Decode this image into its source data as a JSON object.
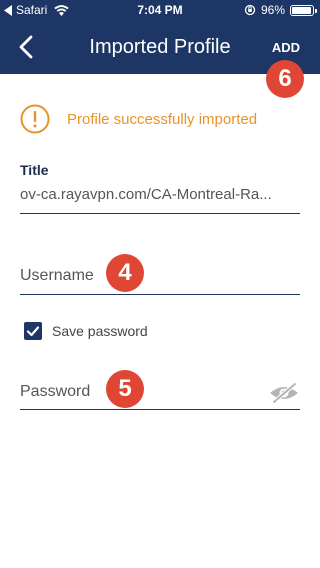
{
  "statusbar": {
    "carrier": "Safari",
    "time": "7:04 PM",
    "battery_percent": "96%",
    "battery_level": 0.96
  },
  "header": {
    "title": "Imported Profile",
    "add_label": "ADD"
  },
  "badges": {
    "add": "6",
    "username": "4",
    "password": "5"
  },
  "notice": {
    "text": "Profile successfully imported"
  },
  "form": {
    "title_label": "Title",
    "title_value": "ov-ca.rayavpn.com/CA-Montreal-Ra...",
    "username_placeholder": "Username",
    "save_password_label": "Save password",
    "save_password_checked": true,
    "password_placeholder": "Password"
  },
  "colors": {
    "header": "#1e3666",
    "accent": "#e8932a",
    "badge": "#e04634"
  }
}
